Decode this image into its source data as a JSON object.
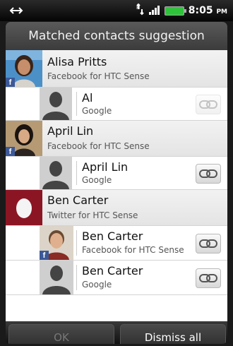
{
  "status_bar": {
    "time": "8:05",
    "ampm": "PM"
  },
  "dialog": {
    "title": "Matched contacts suggestion",
    "groups": [
      {
        "parent": {
          "name": "Alisa Pritts",
          "source": "Facebook for HTC Sense"
        },
        "children": [
          {
            "name": "Al",
            "source": "Google",
            "link_enabled": false
          }
        ]
      },
      {
        "parent": {
          "name": "April Lin",
          "source": "Facebook for HTC Sense"
        },
        "children": [
          {
            "name": "April Lin",
            "source": "Google",
            "link_enabled": true
          }
        ]
      },
      {
        "parent": {
          "name": "Ben Carter",
          "source": "Twitter for HTC Sense"
        },
        "children": [
          {
            "name": "Ben Carter",
            "source": "Facebook for HTC Sense",
            "link_enabled": true
          },
          {
            "name": "Ben Carter",
            "source": "Google",
            "link_enabled": true
          }
        ]
      }
    ],
    "buttons": {
      "ok": "OK",
      "dismiss": "Dismiss all"
    }
  },
  "icons": {
    "status": [
      "usb-sync-icon",
      "data-transfer-icon",
      "signal-bars-icon",
      "battery-icon"
    ],
    "badges": [
      "facebook-badge-icon",
      "twitter-egg-icon",
      "default-contact-icon",
      "link-contacts-icon"
    ]
  },
  "colors": {
    "facebook": "#3b5998",
    "battery": "#2fc33b",
    "twitter_egg_bg": "#8c1524"
  }
}
